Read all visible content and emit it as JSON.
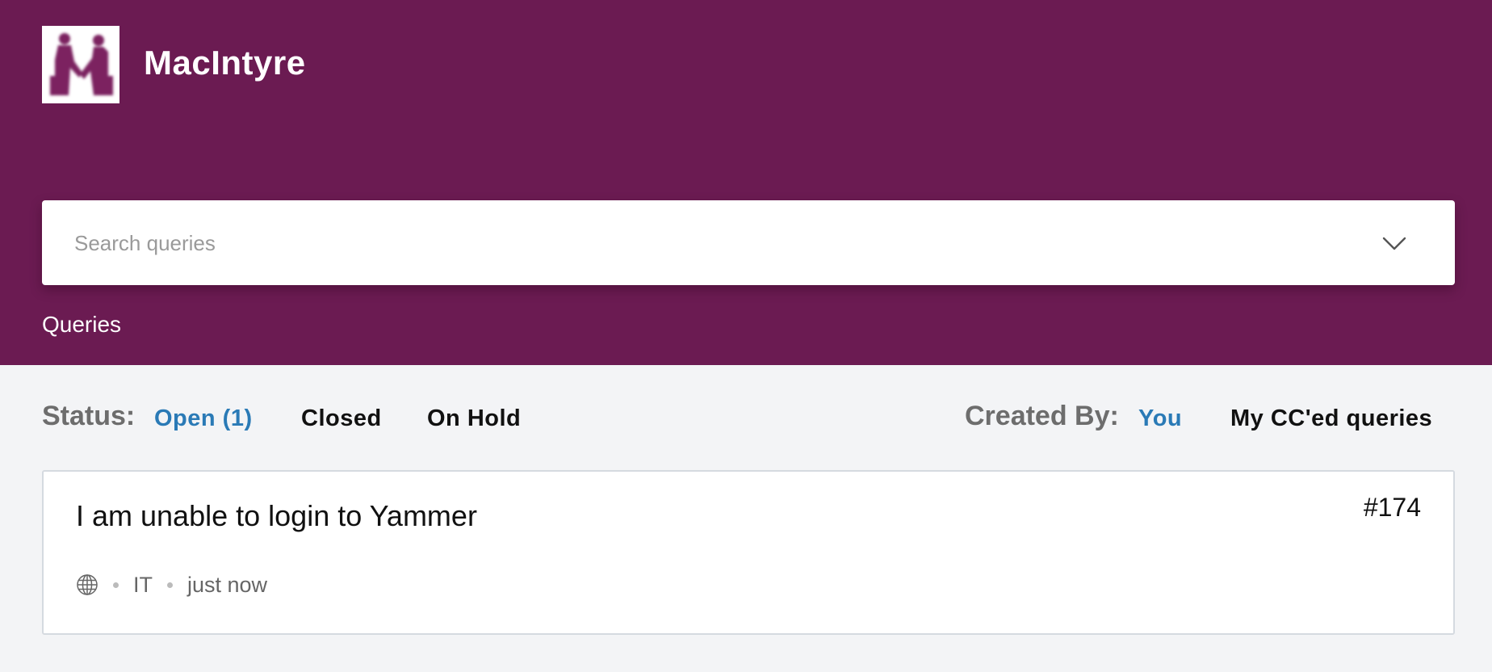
{
  "app": {
    "title": "MacIntyre",
    "logo": "handshake-logo"
  },
  "search": {
    "placeholder": "Search queries",
    "icon": "chevron-down-icon"
  },
  "section": {
    "label": "Queries"
  },
  "filters": {
    "status_label": "Status:",
    "status_options": [
      {
        "label": "Open (1)",
        "active": true
      },
      {
        "label": "Closed",
        "active": false
      },
      {
        "label": "On Hold",
        "active": false
      }
    ],
    "created_by_label": "Created By:",
    "created_by_options": [
      {
        "label": "You",
        "active": true
      },
      {
        "label": "My CC'ed queries",
        "active": false
      }
    ]
  },
  "queries": [
    {
      "title": "I am unable to login to Yammer",
      "id": "#174",
      "icon": "globe-icon",
      "category": "IT",
      "time": "just now"
    }
  ],
  "colors": {
    "header_bg": "#6b1b52",
    "page_bg": "#f3f4f6",
    "active_filter": "#2a7ab6",
    "text_dark": "#111111",
    "text_muted": "#6d6d6d"
  }
}
